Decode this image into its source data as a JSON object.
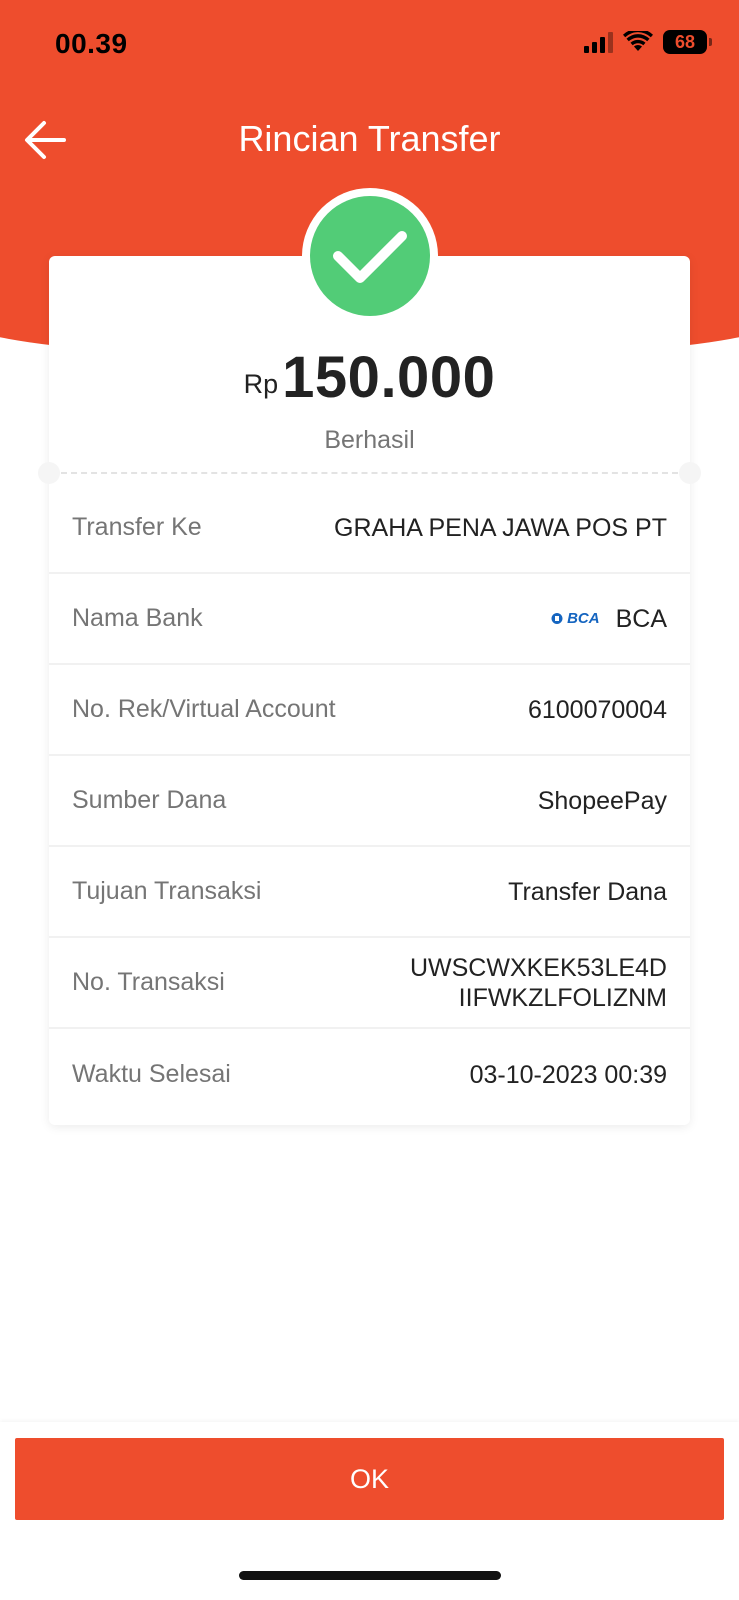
{
  "status_bar": {
    "time": "00.39",
    "battery": "68"
  },
  "header": {
    "title": "Rincian Transfer",
    "back_icon": "arrow-left-icon"
  },
  "summary": {
    "currency": "Rp",
    "amount": "150.000",
    "status": "Berhasil",
    "status_icon": "check-icon"
  },
  "details": {
    "transfer_to": {
      "label": "Transfer Ke",
      "value": "GRAHA PENA JAWA POS PT"
    },
    "bank": {
      "label": "Nama Bank",
      "logo_text": "BCA",
      "value": "BCA"
    },
    "account": {
      "label": "No. Rek/Virtual Account",
      "value": "6100070004"
    },
    "source": {
      "label": "Sumber Dana",
      "value": "ShopeePay"
    },
    "purpose": {
      "label": "Tujuan Transaksi",
      "value": "Transfer Dana"
    },
    "transaction_no": {
      "label": "No. Transaksi",
      "value_line1": "UWSCWXKEK53LE4D",
      "value_line2": "IIFWKZLFOLIZNM"
    },
    "completed_at": {
      "label": "Waktu Selesai",
      "value": "03-10-2023 00:39"
    }
  },
  "actions": {
    "ok_label": "OK"
  },
  "colors": {
    "brand": "#ee4d2d",
    "success": "#52cc77",
    "bank_blue": "#1565c0"
  }
}
